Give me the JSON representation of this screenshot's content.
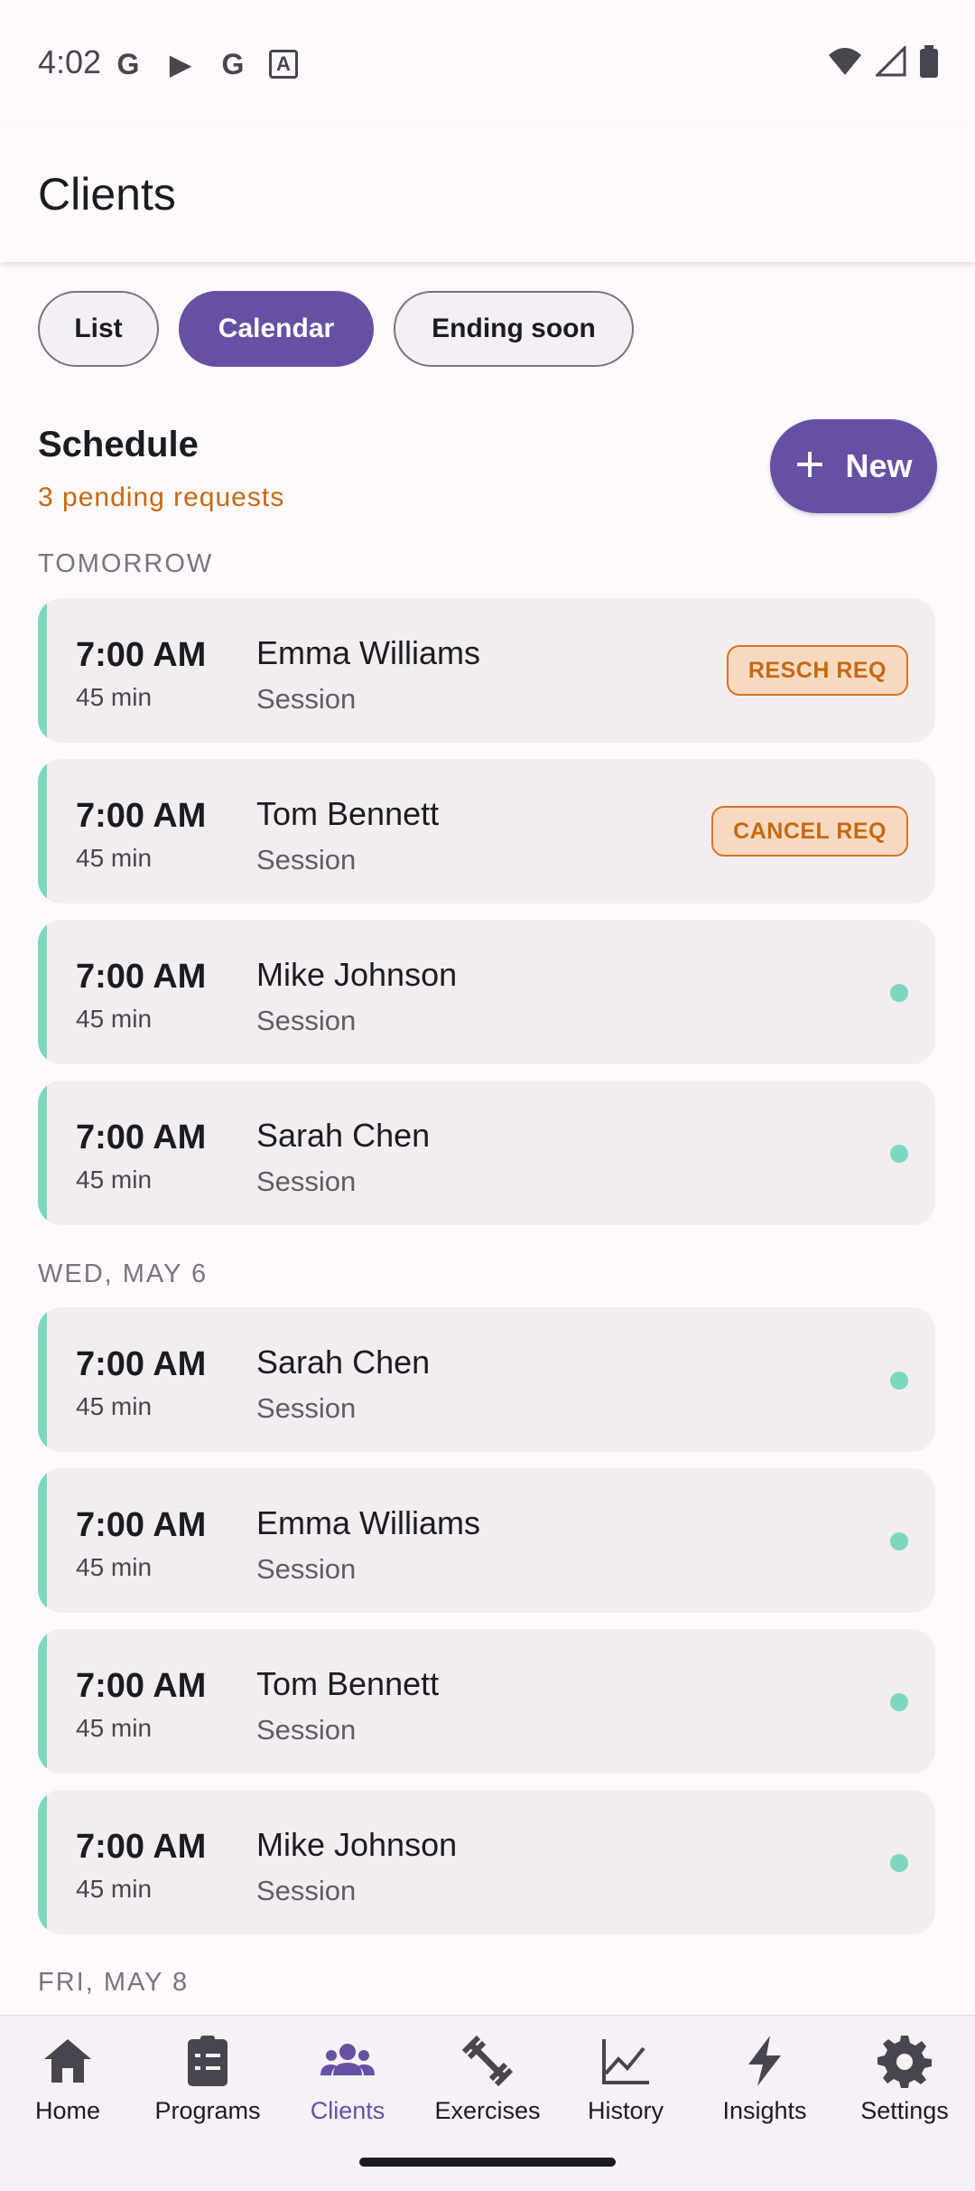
{
  "status_bar": {
    "time": "4:02",
    "left_icons": [
      "G",
      "▶",
      "G",
      "A"
    ]
  },
  "header": {
    "title": "Clients"
  },
  "filters": [
    {
      "label": "List",
      "selected": false
    },
    {
      "label": "Calendar",
      "selected": true
    },
    {
      "label": "Ending soon",
      "selected": false
    }
  ],
  "schedule": {
    "title": "Schedule",
    "pending": "3 pending requests",
    "new_button": "New",
    "new_icon": "plus-icon"
  },
  "sections": [
    {
      "label": "TOMORROW",
      "items": [
        {
          "time": "7:00 AM",
          "duration": "45 min",
          "name": "Emma Williams",
          "type": "Session",
          "badge": "RESCH REQ"
        },
        {
          "time": "7:00 AM",
          "duration": "45 min",
          "name": "Tom Bennett",
          "type": "Session",
          "badge": "CANCEL REQ"
        },
        {
          "time": "7:00 AM",
          "duration": "45 min",
          "name": "Mike Johnson",
          "type": "Session",
          "badge": ""
        },
        {
          "time": "7:00 AM",
          "duration": "45 min",
          "name": "Sarah Chen",
          "type": "Session",
          "badge": ""
        }
      ]
    },
    {
      "label": "WED, MAY 6",
      "items": [
        {
          "time": "7:00 AM",
          "duration": "45 min",
          "name": "Sarah Chen",
          "type": "Session",
          "badge": ""
        },
        {
          "time": "7:00 AM",
          "duration": "45 min",
          "name": "Emma Williams",
          "type": "Session",
          "badge": ""
        },
        {
          "time": "7:00 AM",
          "duration": "45 min",
          "name": "Tom Bennett",
          "type": "Session",
          "badge": ""
        },
        {
          "time": "7:00 AM",
          "duration": "45 min",
          "name": "Mike Johnson",
          "type": "Session",
          "badge": ""
        }
      ]
    },
    {
      "label": "FRI, MAY 8",
      "items": []
    }
  ],
  "nav": [
    {
      "label": "Home",
      "icon": "home-icon",
      "active": false
    },
    {
      "label": "Programs",
      "icon": "clipboard-icon",
      "active": false
    },
    {
      "label": "Clients",
      "icon": "people-icon",
      "active": true
    },
    {
      "label": "Exercises",
      "icon": "dumbbell-icon",
      "active": false
    },
    {
      "label": "History",
      "icon": "chart-line-icon",
      "active": false
    },
    {
      "label": "Insights",
      "icon": "bolt-icon",
      "active": false
    },
    {
      "label": "Settings",
      "icon": "gear-icon",
      "active": false
    }
  ],
  "colors": {
    "primary": "#6750A4",
    "accent_teal": "#7DD7C0",
    "warning": "#C5690F",
    "card_bg": "#F1EDF1"
  }
}
